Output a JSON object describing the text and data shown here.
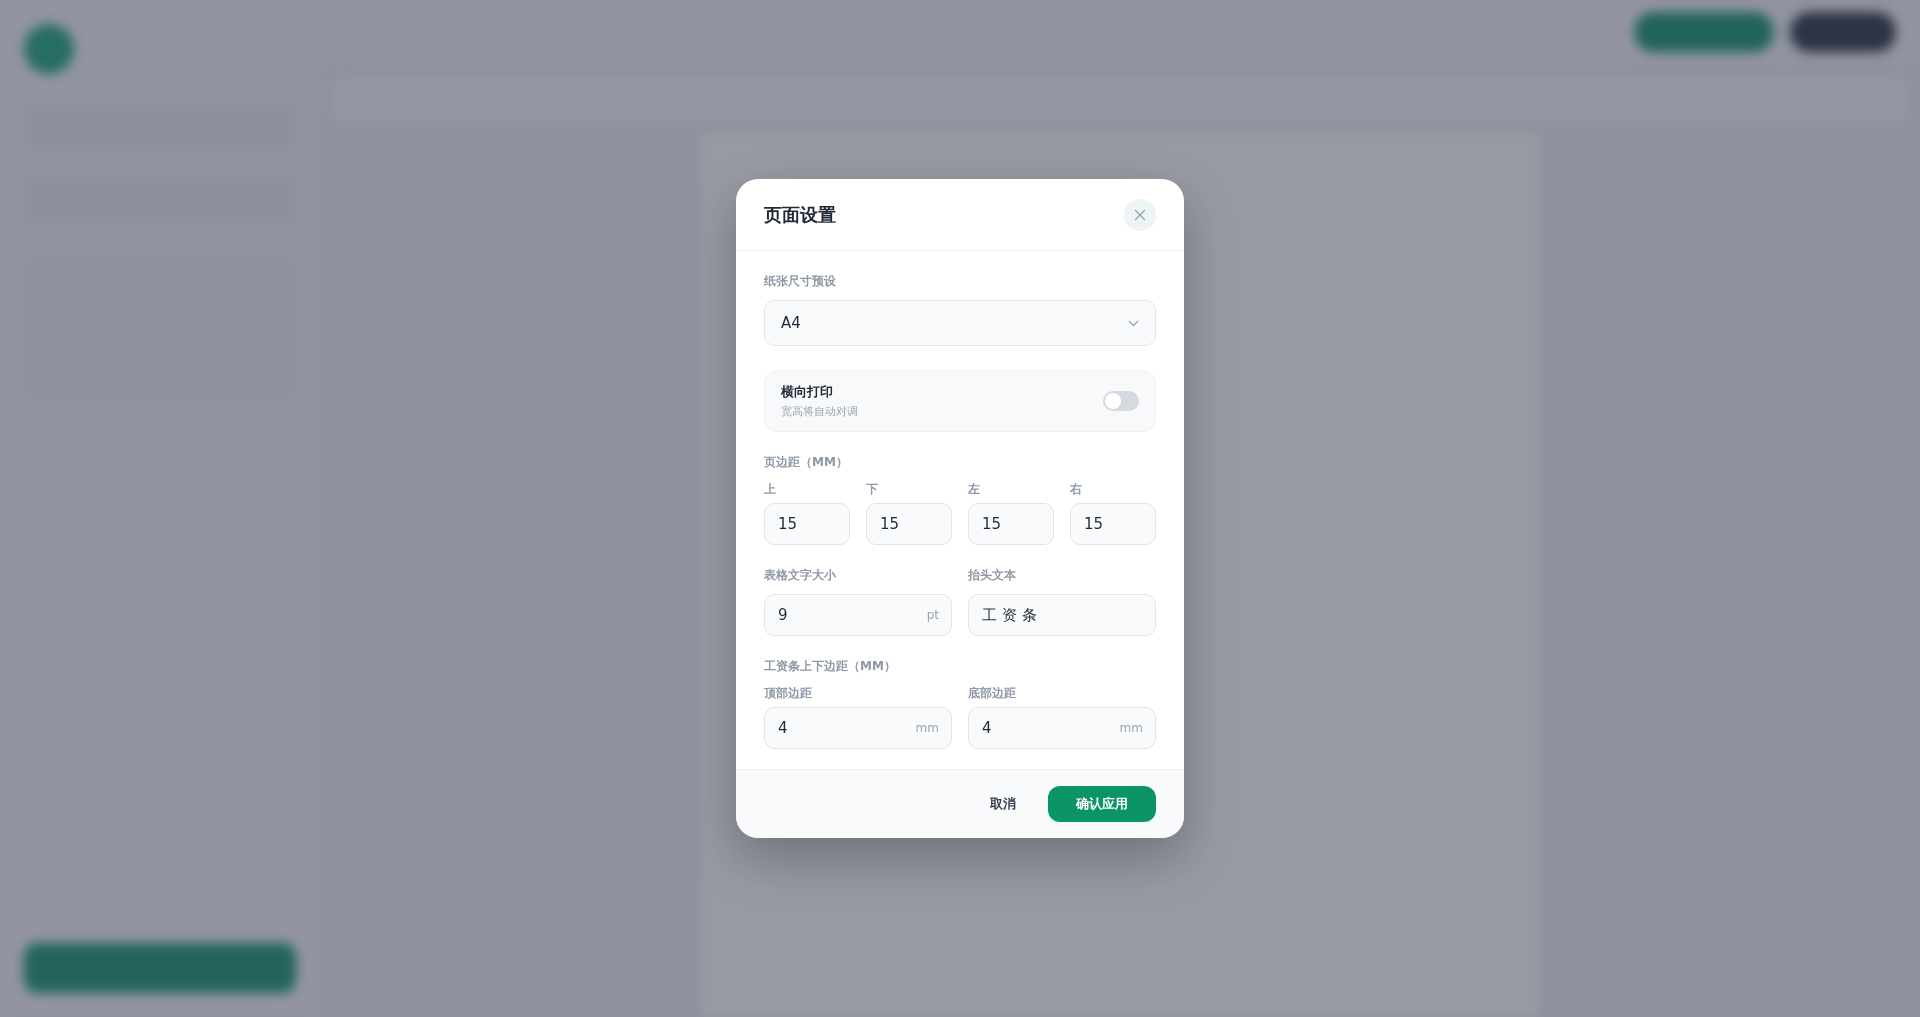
{
  "dialog": {
    "title": "页面设置",
    "paper_preset": {
      "label": "纸张尺寸预设",
      "value": "A4"
    },
    "landscape": {
      "label": "横向打印",
      "hint": "宽高将自动对调",
      "on": false
    },
    "margins": {
      "label": "页边距（MM）",
      "fields": [
        {
          "label": "上",
          "value": "15"
        },
        {
          "label": "下",
          "value": "15"
        },
        {
          "label": "左",
          "value": "15"
        },
        {
          "label": "右",
          "value": "15"
        }
      ]
    },
    "font_size": {
      "label": "表格文字大小",
      "value": "9",
      "unit": "pt"
    },
    "header_text": {
      "label": "抬头文本",
      "value": "工 资 条"
    },
    "slip_margins": {
      "label": "工资条上下边距（MM）",
      "fields": [
        {
          "label": "顶部边距",
          "value": "4",
          "unit": "mm"
        },
        {
          "label": "底部边距",
          "value": "4",
          "unit": "mm"
        }
      ]
    },
    "buttons": [
      {
        "label": "取消",
        "kind": "secondary"
      },
      {
        "label": "确认应用",
        "kind": "primary"
      }
    ]
  }
}
